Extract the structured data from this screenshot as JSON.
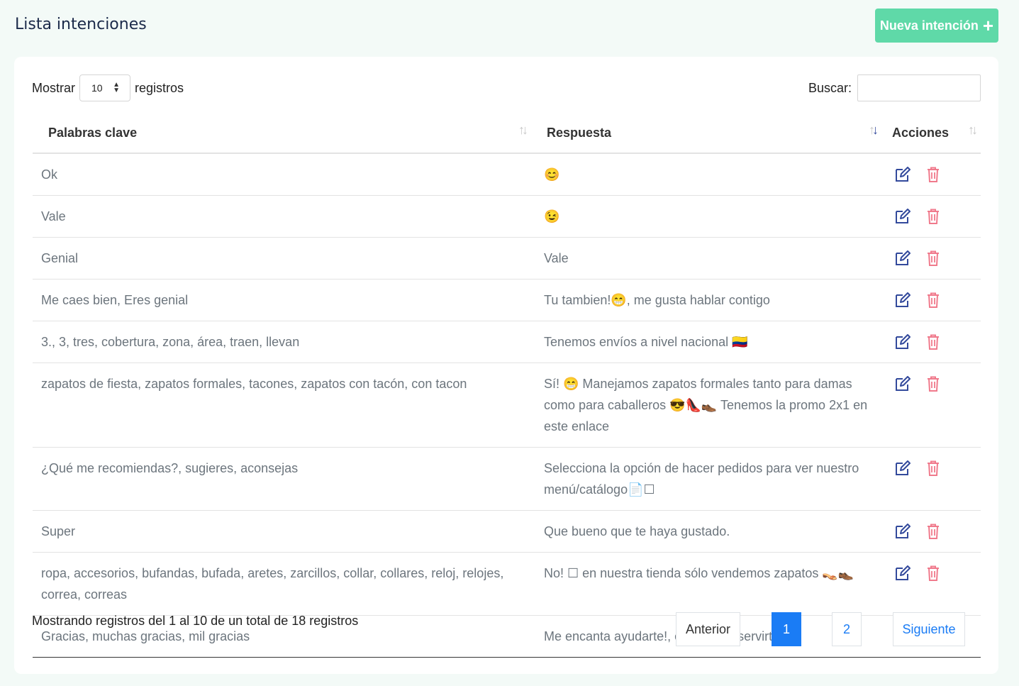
{
  "header": {
    "title": "Lista intenciones",
    "new_button_label": "Nueva intención",
    "accent_color": "#5fd9a8"
  },
  "controls": {
    "show_label": "Mostrar",
    "page_size": "10",
    "records_label": "registros",
    "search_label": "Buscar:",
    "search_value": ""
  },
  "table": {
    "columns": [
      "Palabras clave",
      "Respuesta",
      "Acciones"
    ],
    "rows": [
      {
        "keywords": "Ok",
        "response": "😊"
      },
      {
        "keywords": "Vale",
        "response": "😉"
      },
      {
        "keywords": "Genial",
        "response": "Vale"
      },
      {
        "keywords": "Me caes bien, Eres genial",
        "response": "Tu tambien!😁, me gusta hablar contigo"
      },
      {
        "keywords": "3., 3, tres, cobertura, zona, área, traen, llevan",
        "response": "Tenemos envíos a nivel nacional 🇨🇴"
      },
      {
        "keywords": "zapatos de fiesta, zapatos formales, tacones, zapatos con tacón, con tacon",
        "response": "Sí! 😁 Manejamos zapatos formales tanto para damas como para caballeros 😎👠👞 Tenemos la promo 2x1 en este enlace"
      },
      {
        "keywords": "¿Qué me recomiendas?, sugieres, aconsejas",
        "response": "Selecciona la opción de hacer pedidos para ver nuestro menú/catálogo📄☐"
      },
      {
        "keywords": "Super",
        "response": "Que bueno que te haya gustado."
      },
      {
        "keywords": "ropa, accesorios, bufandas, bufada, aretes, zarcillos, collar, collares, reloj, relojes, correa, correas",
        "response": "No! ☐ en nuestra tienda sólo vendemos zapatos 👡👞"
      },
      {
        "keywords": "Gracias, muchas gracias, mil gracias",
        "response": "Me encanta ayudarte!, estoy para servirte😁"
      }
    ],
    "edit_color": "#334a9c",
    "delete_color": "#f07a8c"
  },
  "footer": {
    "info": "Mostrando registros del 1 al 10 de un total de 18 registros",
    "prev_label": "Anterior",
    "pages": [
      "1",
      "2"
    ],
    "next_label": "Siguiente"
  }
}
